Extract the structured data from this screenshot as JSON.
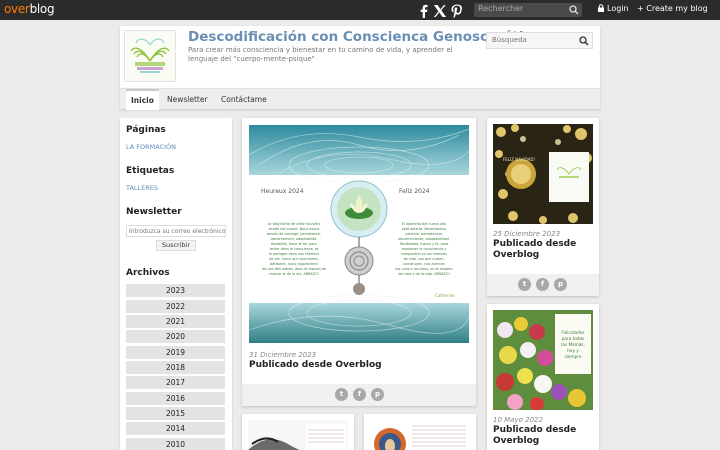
{
  "topbar": {
    "brand_over": "over",
    "brand_blog": "blog",
    "search_placeholder": "Rechercher",
    "login_label": "Login",
    "create_label": "Create my blog",
    "social": [
      "facebook-icon",
      "x-icon",
      "pinterest-icon"
    ]
  },
  "header": {
    "title": "Descodificación con Conscienca Genosomática",
    "subtitle": "Para crear más consciencia y bienestar en tu camino de vida, y aprender el lenguaje del \"cuerpo-mente-psique\"",
    "search_placeholder": "Búsqueda"
  },
  "nav": {
    "items": [
      {
        "label": "Inicio",
        "active": true
      },
      {
        "label": "Newsletter",
        "active": false
      },
      {
        "label": "Contáctame",
        "active": false
      }
    ]
  },
  "sidebar": {
    "pages_heading": "Páginas",
    "pages_link": "LA FORMACIÓN",
    "tags_heading": "Etiquetas",
    "tags_link": "TALLERES",
    "newsletter_heading": "Newsletter",
    "newsletter_placeholder": "Introduzca su correo electrónico",
    "subscribe_label": "Suscribir",
    "archives_heading": "Archivos",
    "years": [
      "2023",
      "2022",
      "2021",
      "2020",
      "2019",
      "2018",
      "2017",
      "2016",
      "2015",
      "2014",
      "2010"
    ]
  },
  "posts": {
    "main": {
      "date": "31 Diciembre 2023",
      "title": "Publicado desde Overblog",
      "image_text": {
        "left_heading": "Heureux 2024",
        "right_heading": "Feliz 2024",
        "left_text": "Le labyrinthe de cette nouvelle année est ouvert. Nous avons besoin de courage, persistance, discernement, adaptabilité, flexibilité, force et foi, pour rester dans la conscience, et le partager dans nos chemins de vie. Cœur qui nourrissent, bâtissent, nous rapprochent les uns des autres, dans le respect de chacun et de la vie. ABRAZO!",
        "right_text": "El laberinto del nuevo año está abierto. Necesitamos valentía, persistencia, discernimiento, adaptabilidad, flexibilidad, fuerza y fe, para mantener la consciencia y compartirla en los caminos de vida. Los que nutren, construyen, nos acercan los unos a los otros, en el respeto del otro y de la vida. ABRAZO!",
        "signature": "Catherine"
      }
    },
    "side1": {
      "date": "25 Diciembre 2023",
      "title": "Publicado desde Overblog",
      "image_text": "FELIZ NAVIDAD!"
    },
    "side2": {
      "date": "10 Mayo 2022",
      "title": "Publicado desde Overblog",
      "image_text": "Felicidades para todas las Mamás, hoy y siempre"
    }
  },
  "colors": {
    "topbar": "#2b2b2b",
    "brand_orange": "#ff7a00",
    "title_blue": "#6a8fb4",
    "link_blue": "#5b8db8",
    "page_bg": "#ebebeb"
  }
}
